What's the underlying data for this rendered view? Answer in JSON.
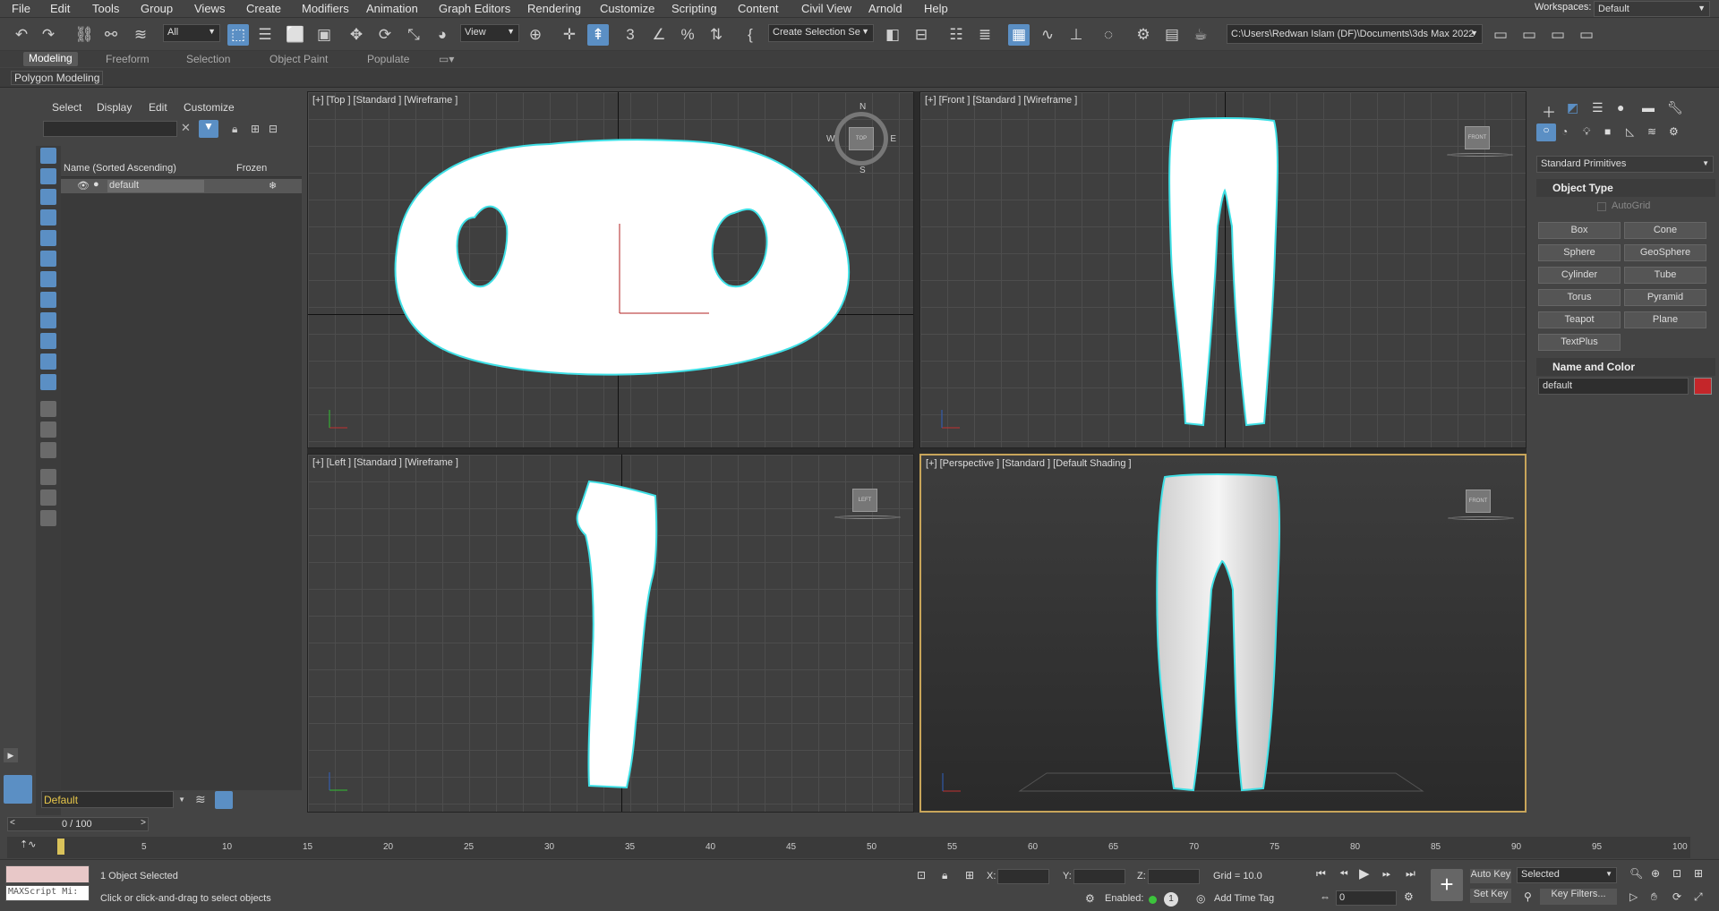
{
  "menubar": {
    "items": [
      "File",
      "Edit",
      "Tools",
      "Group",
      "Views",
      "Create",
      "Modifiers",
      "Animation",
      "Graph Editors",
      "Rendering",
      "Customize",
      "Scripting",
      "Content",
      "Civil View",
      "Arnold",
      "Help"
    ],
    "workspace_label": "Workspaces:",
    "workspace_value": "Default"
  },
  "toolbar": {
    "filter_value": "All",
    "refcoord_value": "View",
    "selection_set_value": "Create Selection Se",
    "project_path": "C:\\Users\\Redwan Islam (DF)\\Documents\\3ds Max 2022"
  },
  "ribbon": {
    "tabs": [
      "Modeling",
      "Freeform",
      "Selection",
      "Object Paint",
      "Populate"
    ],
    "subtab": "Polygon Modeling"
  },
  "scene_explorer": {
    "menus": [
      "Select",
      "Display",
      "Edit",
      "Customize"
    ],
    "col_name": "Name (Sorted Ascending)",
    "col_frozen": "Frozen",
    "row_name": "default",
    "layer_value": "Default"
  },
  "viewports": {
    "top": "[+] [Top ] [Standard ] [Wireframe ]",
    "front": "[+] [Front ] [Standard ] [Wireframe ]",
    "left": "[+] [Left ] [Standard ] [Wireframe ]",
    "persp": "[+] [Perspective ] [Standard ] [Default Shading ]",
    "compass": {
      "n": "N",
      "s": "S",
      "e": "E",
      "w": "W",
      "center": "TOP"
    },
    "cube_front": "FRONT",
    "cube_left": "LEFT"
  },
  "command_panel": {
    "category_value": "Standard Primitives",
    "object_type_title": "Object Type",
    "autogrid_label": "AutoGrid",
    "buttons": [
      "Box",
      "Cone",
      "Sphere",
      "GeoSphere",
      "Cylinder",
      "Tube",
      "Torus",
      "Pyramid",
      "Teapot",
      "Plane",
      "TextPlus"
    ],
    "name_color_title": "Name and Color",
    "name_value": "default",
    "object_color": "#c4262a"
  },
  "timeline": {
    "frame_display": "0 / 100",
    "ticks": [
      "5",
      "10",
      "15",
      "20",
      "25",
      "30",
      "35",
      "40",
      "45",
      "50",
      "55",
      "60",
      "65",
      "70",
      "75",
      "80",
      "85",
      "90",
      "95",
      "100"
    ]
  },
  "status": {
    "maxscript_placeholder": "MAXScript Mi:",
    "selected_text": "1 Object Selected",
    "prompt_text": "Click or click-and-drag to select objects",
    "x_label": "X:",
    "y_label": "Y:",
    "z_label": "Z:",
    "grid_text": "Grid = 10.0",
    "enabled_label": "Enabled:",
    "add_time_tag": "Add Time Tag",
    "auto_key": "Auto Key",
    "set_key": "Set Key",
    "selected_dd": "Selected",
    "key_filters": "Key Filters...",
    "frame_value": "0"
  }
}
